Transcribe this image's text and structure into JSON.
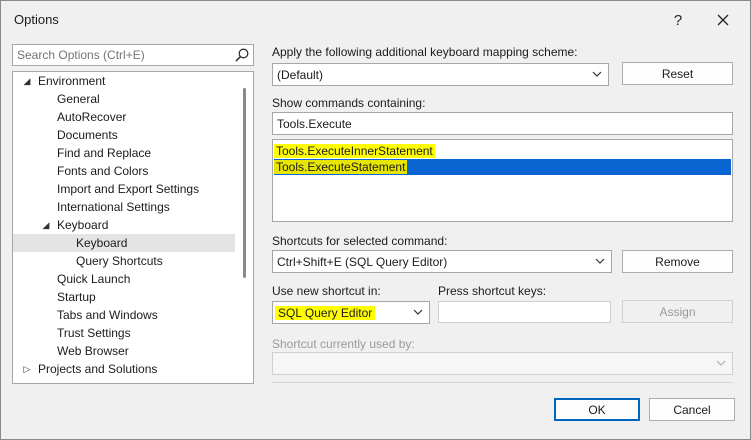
{
  "window": {
    "title": "Options",
    "help_label": "?",
    "close_label": "✕"
  },
  "search": {
    "placeholder": "Search Options (Ctrl+E)"
  },
  "tree": {
    "items": [
      {
        "label": "Environment",
        "level": 0,
        "expanded": true
      },
      {
        "label": "General",
        "level": 1
      },
      {
        "label": "AutoRecover",
        "level": 1
      },
      {
        "label": "Documents",
        "level": 1
      },
      {
        "label": "Find and Replace",
        "level": 1
      },
      {
        "label": "Fonts and Colors",
        "level": 1
      },
      {
        "label": "Import and Export Settings",
        "level": 1
      },
      {
        "label": "International Settings",
        "level": 1
      },
      {
        "label": "Keyboard",
        "level": 1,
        "expanded": true
      },
      {
        "label": "Keyboard",
        "level": 2,
        "selected": true
      },
      {
        "label": "Query Shortcuts",
        "level": 2
      },
      {
        "label": "Quick Launch",
        "level": 1
      },
      {
        "label": "Startup",
        "level": 1
      },
      {
        "label": "Tabs and Windows",
        "level": 1
      },
      {
        "label": "Trust Settings",
        "level": 1
      },
      {
        "label": "Web Browser",
        "level": 1
      },
      {
        "label": "Projects and Solutions",
        "level": 0,
        "expanded": false
      }
    ]
  },
  "mapping": {
    "label": "Apply the following additional keyboard mapping scheme:",
    "value": "(Default)",
    "reset_label": "Reset"
  },
  "commands": {
    "label": "Show commands containing:",
    "filter_value": "Tools.Execute",
    "items": [
      {
        "label": "Tools.ExecuteInnerStatement",
        "selected": false
      },
      {
        "label": "Tools.ExecuteStatement",
        "selected": true
      }
    ]
  },
  "shortcuts": {
    "label": "Shortcuts for selected command:",
    "value": "Ctrl+Shift+E (SQL Query Editor)",
    "remove_label": "Remove"
  },
  "new_shortcut": {
    "use_in_label": "Use new shortcut in:",
    "use_in_value": "SQL Query Editor",
    "press_keys_label": "Press shortcut keys:",
    "press_keys_value": "",
    "assign_label": "Assign"
  },
  "currently_used": {
    "label": "Shortcut currently used by:",
    "value": ""
  },
  "footer": {
    "ok_label": "OK",
    "cancel_label": "Cancel"
  },
  "colors": {
    "highlight": "#ffff00",
    "selection": "#0a64d2",
    "tree_selection": "#e4e4e4"
  }
}
